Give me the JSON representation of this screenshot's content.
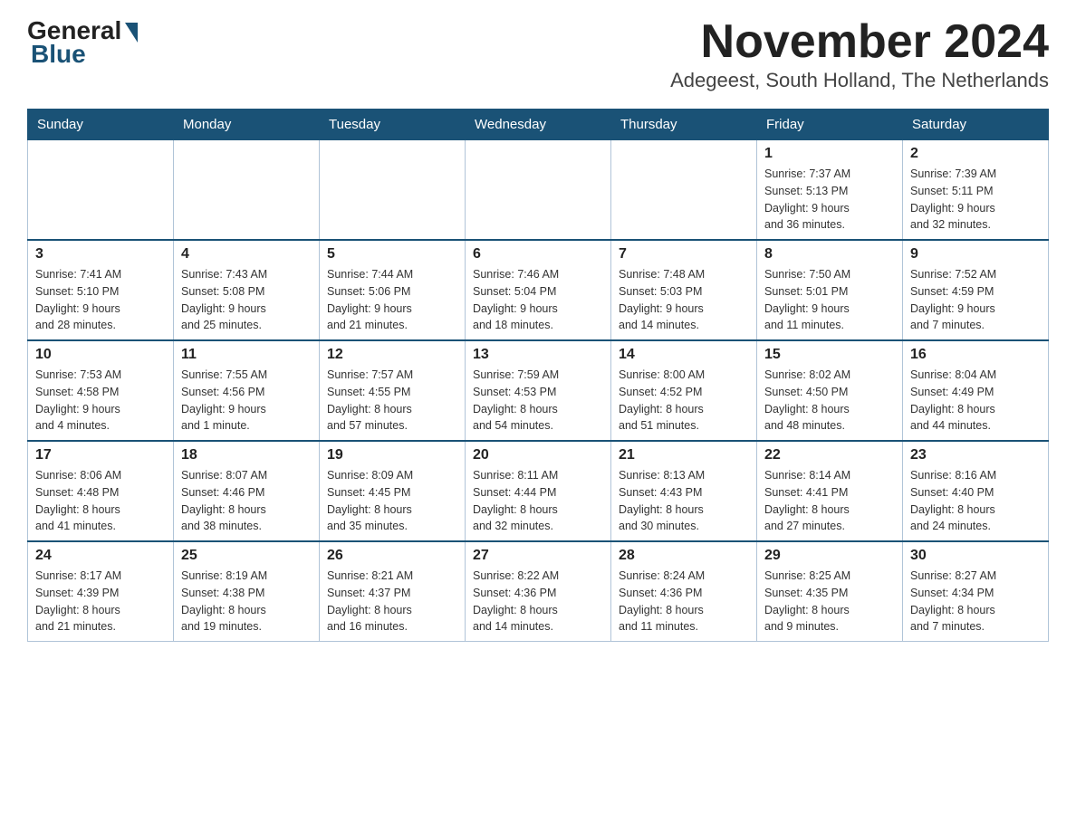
{
  "logo": {
    "general": "General",
    "blue": "Blue"
  },
  "title": "November 2024",
  "subtitle": "Adegeest, South Holland, The Netherlands",
  "days_of_week": [
    "Sunday",
    "Monday",
    "Tuesday",
    "Wednesday",
    "Thursday",
    "Friday",
    "Saturday"
  ],
  "weeks": [
    [
      {
        "day": "",
        "info": ""
      },
      {
        "day": "",
        "info": ""
      },
      {
        "day": "",
        "info": ""
      },
      {
        "day": "",
        "info": ""
      },
      {
        "day": "",
        "info": ""
      },
      {
        "day": "1",
        "info": "Sunrise: 7:37 AM\nSunset: 5:13 PM\nDaylight: 9 hours\nand 36 minutes."
      },
      {
        "day": "2",
        "info": "Sunrise: 7:39 AM\nSunset: 5:11 PM\nDaylight: 9 hours\nand 32 minutes."
      }
    ],
    [
      {
        "day": "3",
        "info": "Sunrise: 7:41 AM\nSunset: 5:10 PM\nDaylight: 9 hours\nand 28 minutes."
      },
      {
        "day": "4",
        "info": "Sunrise: 7:43 AM\nSunset: 5:08 PM\nDaylight: 9 hours\nand 25 minutes."
      },
      {
        "day": "5",
        "info": "Sunrise: 7:44 AM\nSunset: 5:06 PM\nDaylight: 9 hours\nand 21 minutes."
      },
      {
        "day": "6",
        "info": "Sunrise: 7:46 AM\nSunset: 5:04 PM\nDaylight: 9 hours\nand 18 minutes."
      },
      {
        "day": "7",
        "info": "Sunrise: 7:48 AM\nSunset: 5:03 PM\nDaylight: 9 hours\nand 14 minutes."
      },
      {
        "day": "8",
        "info": "Sunrise: 7:50 AM\nSunset: 5:01 PM\nDaylight: 9 hours\nand 11 minutes."
      },
      {
        "day": "9",
        "info": "Sunrise: 7:52 AM\nSunset: 4:59 PM\nDaylight: 9 hours\nand 7 minutes."
      }
    ],
    [
      {
        "day": "10",
        "info": "Sunrise: 7:53 AM\nSunset: 4:58 PM\nDaylight: 9 hours\nand 4 minutes."
      },
      {
        "day": "11",
        "info": "Sunrise: 7:55 AM\nSunset: 4:56 PM\nDaylight: 9 hours\nand 1 minute."
      },
      {
        "day": "12",
        "info": "Sunrise: 7:57 AM\nSunset: 4:55 PM\nDaylight: 8 hours\nand 57 minutes."
      },
      {
        "day": "13",
        "info": "Sunrise: 7:59 AM\nSunset: 4:53 PM\nDaylight: 8 hours\nand 54 minutes."
      },
      {
        "day": "14",
        "info": "Sunrise: 8:00 AM\nSunset: 4:52 PM\nDaylight: 8 hours\nand 51 minutes."
      },
      {
        "day": "15",
        "info": "Sunrise: 8:02 AM\nSunset: 4:50 PM\nDaylight: 8 hours\nand 48 minutes."
      },
      {
        "day": "16",
        "info": "Sunrise: 8:04 AM\nSunset: 4:49 PM\nDaylight: 8 hours\nand 44 minutes."
      }
    ],
    [
      {
        "day": "17",
        "info": "Sunrise: 8:06 AM\nSunset: 4:48 PM\nDaylight: 8 hours\nand 41 minutes."
      },
      {
        "day": "18",
        "info": "Sunrise: 8:07 AM\nSunset: 4:46 PM\nDaylight: 8 hours\nand 38 minutes."
      },
      {
        "day": "19",
        "info": "Sunrise: 8:09 AM\nSunset: 4:45 PM\nDaylight: 8 hours\nand 35 minutes."
      },
      {
        "day": "20",
        "info": "Sunrise: 8:11 AM\nSunset: 4:44 PM\nDaylight: 8 hours\nand 32 minutes."
      },
      {
        "day": "21",
        "info": "Sunrise: 8:13 AM\nSunset: 4:43 PM\nDaylight: 8 hours\nand 30 minutes."
      },
      {
        "day": "22",
        "info": "Sunrise: 8:14 AM\nSunset: 4:41 PM\nDaylight: 8 hours\nand 27 minutes."
      },
      {
        "day": "23",
        "info": "Sunrise: 8:16 AM\nSunset: 4:40 PM\nDaylight: 8 hours\nand 24 minutes."
      }
    ],
    [
      {
        "day": "24",
        "info": "Sunrise: 8:17 AM\nSunset: 4:39 PM\nDaylight: 8 hours\nand 21 minutes."
      },
      {
        "day": "25",
        "info": "Sunrise: 8:19 AM\nSunset: 4:38 PM\nDaylight: 8 hours\nand 19 minutes."
      },
      {
        "day": "26",
        "info": "Sunrise: 8:21 AM\nSunset: 4:37 PM\nDaylight: 8 hours\nand 16 minutes."
      },
      {
        "day": "27",
        "info": "Sunrise: 8:22 AM\nSunset: 4:36 PM\nDaylight: 8 hours\nand 14 minutes."
      },
      {
        "day": "28",
        "info": "Sunrise: 8:24 AM\nSunset: 4:36 PM\nDaylight: 8 hours\nand 11 minutes."
      },
      {
        "day": "29",
        "info": "Sunrise: 8:25 AM\nSunset: 4:35 PM\nDaylight: 8 hours\nand 9 minutes."
      },
      {
        "day": "30",
        "info": "Sunrise: 8:27 AM\nSunset: 4:34 PM\nDaylight: 8 hours\nand 7 minutes."
      }
    ]
  ]
}
